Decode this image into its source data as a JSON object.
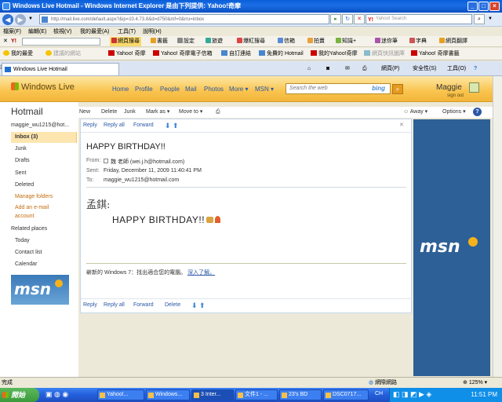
{
  "browser": {
    "title": "Windows Live Hotmail - Windows Internet Explorer 是由下列提供: Yahoo!奇摩",
    "address": "http://mail.live.com/default.aspx?&ip=10.4.73.8&d=d750&mf=0&rru=inbox",
    "search_placeholder": "Yahoo! Search",
    "menu": [
      "檔案(F)",
      "編輯(E)",
      "檢視(V)",
      "我的最愛(A)",
      "工具(T)",
      "說明(H)"
    ],
    "yahoo_toolbar": [
      "網頁搜尋",
      "書籤",
      "設定",
      "旅遊",
      "爆紅搜尋",
      "信箱",
      "拍賣",
      "知識+",
      "迷你筆",
      "字典",
      "網頁翻譯"
    ],
    "favorites_label": "我的最愛",
    "favorites": [
      "建議的網站",
      "Yahoo! 奇摩",
      "Yahoo! 奇摩電子信箱",
      "自訂連結",
      "免費的 Hotmail",
      "我的Yahoo!奇摩",
      "網頁快訊圖庫",
      "Yahoo! 奇摩書籤"
    ],
    "tab_title": "Windows Live Hotmail",
    "commands": [
      "網頁(P)",
      "安全性(S)",
      "工具(O)"
    ],
    "status_left": "完成",
    "status_zone": "網際網路",
    "zoom": "125%"
  },
  "wl_header": {
    "logo": "Windows Live",
    "nav": [
      "Home",
      "Profile",
      "People",
      "Mail",
      "Photos",
      "More",
      "MSN"
    ],
    "search_placeholder": "Search the web",
    "search_brand": "bing",
    "user_name": "Maggie",
    "sign_out": "sign out"
  },
  "sidebar": {
    "title": "Hotmail",
    "account": "maggie_wu1215@hot...",
    "folders": [
      "Inbox (3)",
      "Junk",
      "Drafts",
      "Sent",
      "Deleted",
      "Manage folders",
      "Add an e-mail account"
    ],
    "related_label": "Related places",
    "related": [
      "Today",
      "Contact list",
      "Calendar"
    ],
    "ad_brand": "msn"
  },
  "mail_toolbar": {
    "actions": [
      "New",
      "Delete",
      "Junk",
      "Mark as",
      "Move to"
    ],
    "away": "Away",
    "options": "Options"
  },
  "message": {
    "top_actions": [
      "Reply",
      "Reply all",
      "Forward"
    ],
    "subject": "HAPPY BIRTHDAY!!",
    "from_label": "From:",
    "from": "魏 老師 (wei.j.h@hotmail.com)",
    "sent_label": "Sent:",
    "sent": "Friday, December 11, 2009 11:40:41 PM",
    "to_label": "To:",
    "to": "maggie_wu1215@hotmail.com",
    "salutation": "孟錤:",
    "body": "HAPPY  BIRTHDAY!!",
    "ad_text": "嶄新的 Windows 7：找出適合您的電腦。",
    "ad_link": "深入了解。",
    "bottom_actions": [
      "Reply",
      "Reply all",
      "Forward",
      "Delete"
    ]
  },
  "right_ad": {
    "brand": "msn"
  },
  "taskbar": {
    "start": "開始",
    "tasks": [
      "Yahoo!...",
      "Windows...",
      "3 Inter...",
      "文件1 - ...",
      "23's BD",
      "DSC0717..."
    ],
    "lang": "CH",
    "time": "11:51 PM"
  },
  "colors": {
    "hotmail_header": "#f9c44f",
    "link": "#2a57a8",
    "inbox_highlight": "#fde5b0",
    "msn_panel": "#2d6096"
  }
}
